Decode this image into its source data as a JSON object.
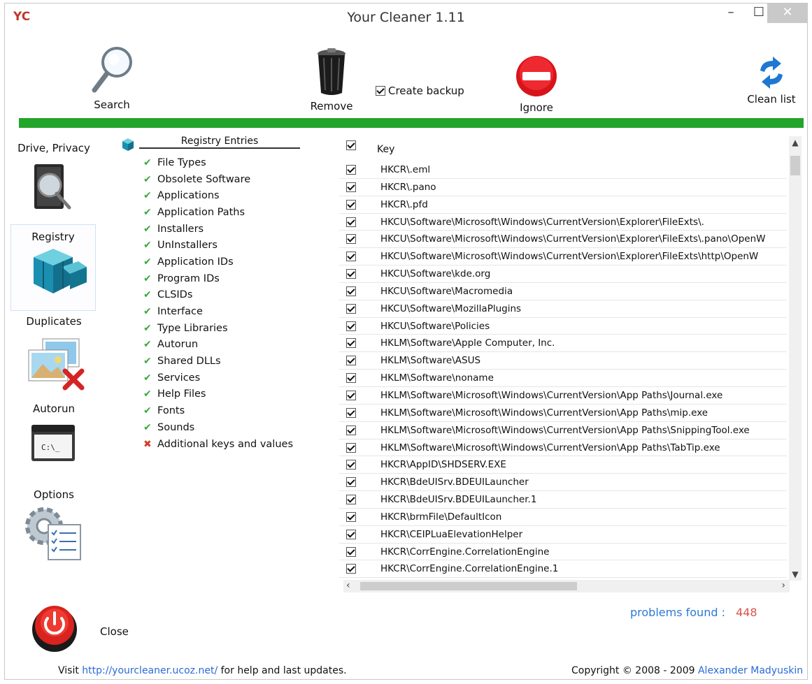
{
  "window": {
    "logo": "YC",
    "title": "Your Cleaner 1.11",
    "minimize": "–",
    "maximize": "☐",
    "close": "✕"
  },
  "toolbar": {
    "search_label": "Search",
    "remove_label": "Remove",
    "create_backup_label": "Create backup",
    "create_backup_checked": true,
    "ignore_label": "Ignore",
    "clean_list_label": "Clean list",
    "progress_fraction": 1.0,
    "progress_color": "#22a52a"
  },
  "nav": {
    "drive_privacy": "Drive, Privacy",
    "registry": "Registry",
    "duplicates": "Duplicates",
    "autorun": "Autorun",
    "options": "Options",
    "selected": "registry"
  },
  "categories": {
    "header": "Registry Entries",
    "items": [
      {
        "label": "File Types",
        "state": "ok"
      },
      {
        "label": "Obsolete Software",
        "state": "ok"
      },
      {
        "label": "Applications",
        "state": "ok"
      },
      {
        "label": "Application Paths",
        "state": "ok"
      },
      {
        "label": "Installers",
        "state": "ok"
      },
      {
        "label": "UnInstallers",
        "state": "ok"
      },
      {
        "label": "Application IDs",
        "state": "ok"
      },
      {
        "label": "Program IDs",
        "state": "ok"
      },
      {
        "label": "CLSIDs",
        "state": "ok"
      },
      {
        "label": "Interface",
        "state": "ok"
      },
      {
        "label": "Type Libraries",
        "state": "ok"
      },
      {
        "label": "Autorun",
        "state": "ok"
      },
      {
        "label": "Shared DLLs",
        "state": "ok"
      },
      {
        "label": "Services",
        "state": "ok"
      },
      {
        "label": "Help Files",
        "state": "ok"
      },
      {
        "label": "Fonts",
        "state": "ok"
      },
      {
        "label": "Sounds",
        "state": "ok"
      },
      {
        "label": "Additional keys and values",
        "state": "error"
      }
    ]
  },
  "key_list": {
    "header": "Key",
    "rows": [
      "HKCR\\.eml",
      "HKCR\\.pano",
      "HKCR\\.pfd",
      "HKCU\\Software\\Microsoft\\Windows\\CurrentVersion\\Explorer\\FileExts\\.",
      "HKCU\\Software\\Microsoft\\Windows\\CurrentVersion\\Explorer\\FileExts\\.pano\\OpenW",
      "HKCU\\Software\\Microsoft\\Windows\\CurrentVersion\\Explorer\\FileExts\\http\\OpenW",
      "HKCU\\Software\\kde.org",
      "HKCU\\Software\\Macromedia",
      "HKCU\\Software\\MozillaPlugins",
      "HKCU\\Software\\Policies",
      "HKLM\\Software\\Apple Computer, Inc.",
      "HKLM\\Software\\ASUS",
      "HKLM\\Software\\noname",
      "HKLM\\Software\\Microsoft\\Windows\\CurrentVersion\\App Paths\\Journal.exe",
      "HKLM\\Software\\Microsoft\\Windows\\CurrentVersion\\App Paths\\mip.exe",
      "HKLM\\Software\\Microsoft\\Windows\\CurrentVersion\\App Paths\\SnippingTool.exe",
      "HKLM\\Software\\Microsoft\\Windows\\CurrentVersion\\App Paths\\TabTip.exe",
      "HKCR\\AppID\\SHDSERV.EXE",
      "HKCR\\BdeUISrv.BDEUILauncher",
      "HKCR\\BdeUISrv.BDEUILauncher.1",
      "HKCR\\brmFile\\DefaultIcon",
      "HKCR\\CEIPLuaElevationHelper",
      "HKCR\\CorrEngine.CorrelationEngine",
      "HKCR\\CorrEngine.CorrelationEngine.1"
    ]
  },
  "status": {
    "problems_label": "problems found :",
    "problems_count": "448"
  },
  "close_label": "Close",
  "footer": {
    "visit": "Visit",
    "url": "http://yourcleaner.ucoz.net/",
    "suffix": "for help and last updates.",
    "copyright": "Copyright © 2008 - 2009",
    "author": "Alexander Madyuskin"
  },
  "icons": {
    "search": "magnifier-icon",
    "remove": "trash-can-icon",
    "ignore": "no-entry-icon",
    "clean_list": "refresh-arrows-icon",
    "drive_privacy": "drive-magnifier-icon",
    "registry": "registry-cubes-icon",
    "duplicates": "duplicate-images-icon",
    "autorun": "console-window-icon",
    "options": "gear-checklist-icon",
    "close": "power-button-icon"
  }
}
